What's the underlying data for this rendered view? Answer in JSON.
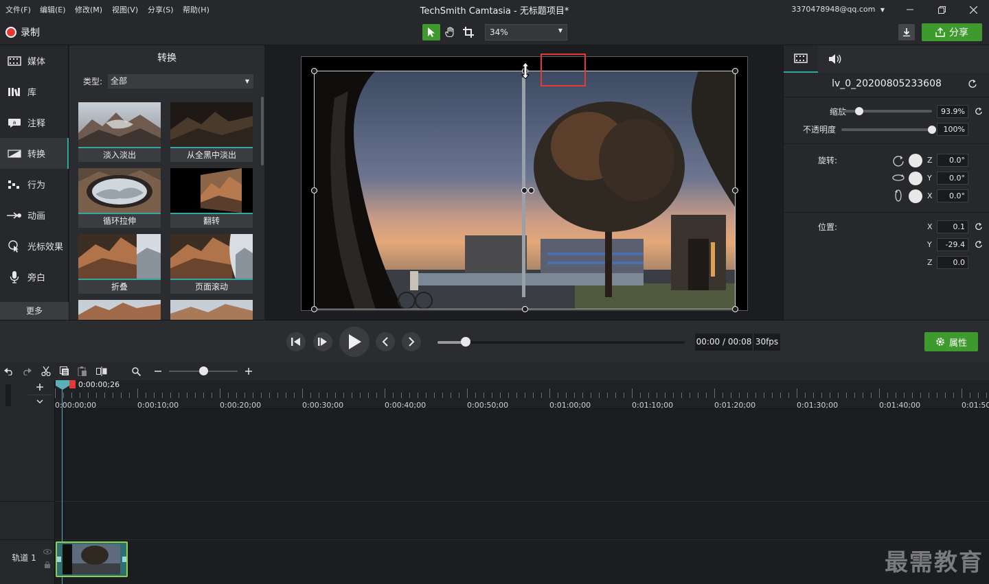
{
  "menu": [
    "文件(F)",
    "编辑(E)",
    "修改(M)",
    "视图(V)",
    "分享(S)",
    "帮助(H)"
  ],
  "app_title": "TechSmith Camtasia - 无标题项目*",
  "account": "3370478948@qq.com",
  "toolbar": {
    "record_label": "录制",
    "zoom_value": "34%",
    "share_label": "分享"
  },
  "leftnav": {
    "items": [
      {
        "label": "媒体",
        "icon": "film-icon"
      },
      {
        "label": "库",
        "icon": "library-icon"
      },
      {
        "label": "注释",
        "icon": "annotation-icon"
      },
      {
        "label": "转换",
        "icon": "transition-icon"
      },
      {
        "label": "行为",
        "icon": "behavior-icon"
      },
      {
        "label": "动画",
        "icon": "animation-icon"
      },
      {
        "label": "光标效果",
        "icon": "cursor-effect-icon"
      },
      {
        "label": "旁白",
        "icon": "microphone-icon"
      }
    ],
    "active_index": 3,
    "more_label": "更多"
  },
  "transitions": {
    "title": "转换",
    "type_label": "类型:",
    "type_value": "全部",
    "items": [
      "淡入淡出",
      "从全黑中淡出",
      "循环拉伸",
      "翻转",
      "折叠",
      "页面滚动"
    ]
  },
  "properties": {
    "media_name": "lv_0_20200805233608",
    "scale_label": "缩放",
    "scale_value": "93.9%",
    "scale_fraction": 0.2,
    "opacity_label": "不透明度",
    "opacity_value": "100%",
    "opacity_fraction": 1.0,
    "rotation_label": "旋转:",
    "rotation": {
      "z": "0.0°",
      "y": "0.0°",
      "x": "0.0°"
    },
    "position_label": "位置:",
    "position": {
      "x": "0.1",
      "y": "-29.4",
      "z": "0.0"
    },
    "axes": {
      "z": "Z",
      "y": "Y",
      "x": "X"
    }
  },
  "playback": {
    "timecode": "00:00 / 00:08",
    "fps": "30fps",
    "properties_label": "属性",
    "progress_fraction": 0.11
  },
  "timeline": {
    "playhead_time": "0:00:00;26",
    "ticks": [
      "0:00:00;00",
      "0:00:10;00",
      "0:00:20;00",
      "0:00:30;00",
      "0:00:40;00",
      "0:00:50;00",
      "0:01:00;00",
      "0:01:10;00",
      "0:01:20;00",
      "0:01:30;00",
      "0:01:40;00",
      "0:01:50;00"
    ],
    "track_label": "轨道 1"
  },
  "watermark": "最需教育",
  "colors": {
    "accent_green": "#3f9a2d",
    "accent_teal": "#2ea8a0",
    "record_red": "#e53935",
    "highlight_red": "#e53935"
  }
}
